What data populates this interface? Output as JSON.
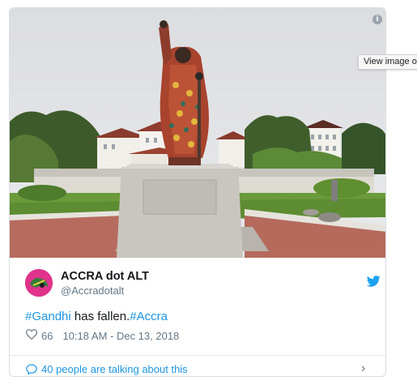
{
  "tooltip": {
    "text": "View image on Twitter"
  },
  "author": {
    "name": "ACCRA dot ALT",
    "handle": "@Accradotalt"
  },
  "tweet": {
    "hashtag1": "#Gandhi",
    "text_middle": " has fallen.",
    "hashtag2": "#Accra"
  },
  "meta": {
    "likes": "66",
    "timestamp": "10:18 AM - Dec 13, 2018"
  },
  "conversation": {
    "label": "40 people are talking about this"
  },
  "icons": {
    "info": "info-icon",
    "bird": "twitter-bird-icon",
    "heart": "heart-icon",
    "reply": "speech-bubble-icon",
    "chevron": "chevron-right-icon"
  },
  "colors": {
    "link": "#1b95e0",
    "text": "#14171a",
    "secondary": "#657786",
    "border": "#d9dee2"
  }
}
